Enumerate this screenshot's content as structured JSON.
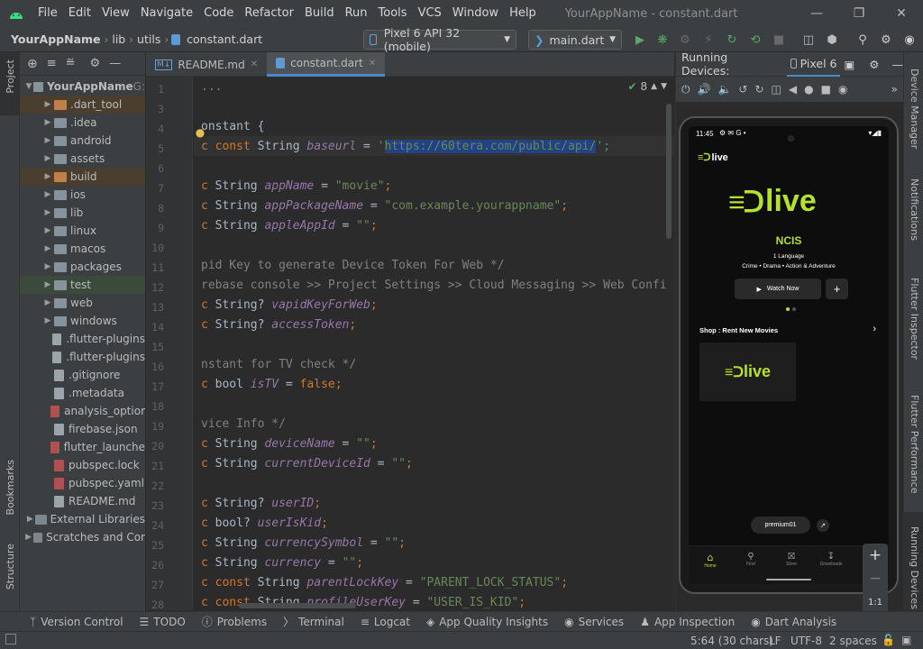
{
  "menu": {
    "items": [
      "File",
      "Edit",
      "View",
      "Navigate",
      "Code",
      "Refactor",
      "Build",
      "Run",
      "Tools",
      "VCS",
      "Window",
      "Help"
    ],
    "window_title": "YourAppName - constant.dart"
  },
  "nav": {
    "crumbs": [
      "YourAppName",
      "lib",
      "utils",
      "constant.dart"
    ],
    "device_combo": "Pixel 6 API 32 (mobile)",
    "run_config": "main.dart"
  },
  "left_stripe": {
    "project": "Project",
    "bookmarks": "Bookmarks",
    "structure": "Structure"
  },
  "right_stripe": {
    "device_manager": "Device Manager",
    "notifications": "Notifications",
    "flutter_inspector": "Flutter Inspector",
    "flutter_performance": "Flutter Performance",
    "running_devices": "Running Devices"
  },
  "project_tree": [
    {
      "label": "YourAppName",
      "suffix": "G:",
      "level": 0,
      "kind": "root",
      "expanded": true
    },
    {
      "label": ".dart_tool",
      "level": 1,
      "kind": "folder-orange",
      "hl": "brown"
    },
    {
      "label": ".idea",
      "level": 1,
      "kind": "folder"
    },
    {
      "label": "android",
      "level": 1,
      "kind": "folder"
    },
    {
      "label": "assets",
      "level": 1,
      "kind": "folder"
    },
    {
      "label": "build",
      "level": 1,
      "kind": "folder-orange",
      "hl": "brown"
    },
    {
      "label": "ios",
      "level": 1,
      "kind": "folder"
    },
    {
      "label": "lib",
      "level": 1,
      "kind": "folder"
    },
    {
      "label": "linux",
      "level": 1,
      "kind": "folder"
    },
    {
      "label": "macos",
      "level": 1,
      "kind": "folder"
    },
    {
      "label": "packages",
      "level": 1,
      "kind": "folder"
    },
    {
      "label": "test",
      "level": 1,
      "kind": "folder",
      "hl": "green"
    },
    {
      "label": "web",
      "level": 1,
      "kind": "folder"
    },
    {
      "label": "windows",
      "level": 1,
      "kind": "folder"
    },
    {
      "label": ".flutter-plugins",
      "level": 1,
      "kind": "file"
    },
    {
      "label": ".flutter-plugins",
      "level": 1,
      "kind": "file"
    },
    {
      "label": ".gitignore",
      "level": 1,
      "kind": "file"
    },
    {
      "label": ".metadata",
      "level": 1,
      "kind": "file"
    },
    {
      "label": "analysis_optior",
      "level": 1,
      "kind": "yml"
    },
    {
      "label": "firebase.json",
      "level": 1,
      "kind": "file"
    },
    {
      "label": "flutter_launche",
      "level": 1,
      "kind": "yml"
    },
    {
      "label": "pubspec.lock",
      "level": 1,
      "kind": "yml"
    },
    {
      "label": "pubspec.yaml",
      "level": 1,
      "kind": "yml"
    },
    {
      "label": "README.md",
      "level": 1,
      "kind": "file"
    },
    {
      "label": "External Libraries",
      "level": 0,
      "kind": "lib"
    },
    {
      "label": "Scratches and Cor",
      "level": 0,
      "kind": "scratch"
    }
  ],
  "tabs": [
    {
      "label": "README.md",
      "active": false
    },
    {
      "label": "constant.dart",
      "active": true
    }
  ],
  "editor": {
    "inspection_count": "8",
    "line_numbers": [
      "1",
      "3",
      "4",
      "5",
      "6",
      "7",
      "8",
      "9",
      "10",
      "11",
      "12",
      "13",
      "14",
      "15",
      "16",
      "17",
      "18",
      "19",
      "20",
      "21",
      "22",
      "23",
      "24",
      "25",
      "26",
      "27",
      "28"
    ],
    "lines": [
      [
        {
          "t": "...",
          "c": "cm"
        }
      ],
      [],
      [
        {
          "t": "onstant {",
          "c": "plain"
        }
      ],
      [
        {
          "t": "c ",
          "c": "kw"
        },
        {
          "t": "const ",
          "c": "kw"
        },
        {
          "t": "String ",
          "c": "plain"
        },
        {
          "t": "baseurl",
          "c": "id"
        },
        {
          "t": " = ",
          "c": "plain"
        },
        {
          "t": "'",
          "c": "str"
        },
        {
          "t": "https://60tera.com/public/api/",
          "c": "str sel"
        },
        {
          "t": "';",
          "c": "str"
        }
      ],
      [],
      [
        {
          "t": "c ",
          "c": "kw"
        },
        {
          "t": "String ",
          "c": "plain"
        },
        {
          "t": "appName",
          "c": "id"
        },
        {
          "t": " = ",
          "c": "plain"
        },
        {
          "t": "\"movie\"",
          "c": "str"
        },
        {
          "t": ";",
          "c": "kw"
        }
      ],
      [
        {
          "t": "c ",
          "c": "kw"
        },
        {
          "t": "String ",
          "c": "plain"
        },
        {
          "t": "appPackageName",
          "c": "id"
        },
        {
          "t": " = ",
          "c": "plain"
        },
        {
          "t": "\"com.example.yourappname\"",
          "c": "str"
        },
        {
          "t": ";",
          "c": "kw"
        }
      ],
      [
        {
          "t": "c ",
          "c": "kw"
        },
        {
          "t": "String ",
          "c": "plain"
        },
        {
          "t": "appleAppId",
          "c": "id"
        },
        {
          "t": " = ",
          "c": "plain"
        },
        {
          "t": "\"\"",
          "c": "str"
        },
        {
          "t": ";",
          "c": "kw"
        }
      ],
      [],
      [
        {
          "t": "pid Key to generate Device Token For Web */",
          "c": "cm"
        }
      ],
      [
        {
          "t": "rebase console >> Project Settings >> Cloud Messaging >> Web Confi",
          "c": "cm"
        }
      ],
      [
        {
          "t": "c ",
          "c": "kw"
        },
        {
          "t": "String? ",
          "c": "plain"
        },
        {
          "t": "vapidKeyForWeb",
          "c": "id"
        },
        {
          "t": ";",
          "c": "kw"
        }
      ],
      [
        {
          "t": "c ",
          "c": "kw"
        },
        {
          "t": "String? ",
          "c": "plain"
        },
        {
          "t": "accessToken",
          "c": "id"
        },
        {
          "t": ";",
          "c": "kw"
        }
      ],
      [],
      [
        {
          "t": "nstant for TV check */",
          "c": "cm"
        }
      ],
      [
        {
          "t": "c ",
          "c": "kw"
        },
        {
          "t": "bool ",
          "c": "plain"
        },
        {
          "t": "isTV",
          "c": "id"
        },
        {
          "t": " = ",
          "c": "plain"
        },
        {
          "t": "false",
          "c": "kw"
        },
        {
          "t": ";",
          "c": "kw"
        }
      ],
      [],
      [
        {
          "t": "vice Info */",
          "c": "cm"
        }
      ],
      [
        {
          "t": "c ",
          "c": "kw"
        },
        {
          "t": "String ",
          "c": "plain"
        },
        {
          "t": "deviceName",
          "c": "id"
        },
        {
          "t": " = ",
          "c": "plain"
        },
        {
          "t": "\"\"",
          "c": "str"
        },
        {
          "t": ";",
          "c": "kw"
        }
      ],
      [
        {
          "t": "c ",
          "c": "kw"
        },
        {
          "t": "String ",
          "c": "plain"
        },
        {
          "t": "currentDeviceId",
          "c": "id"
        },
        {
          "t": " = ",
          "c": "plain"
        },
        {
          "t": "\"\"",
          "c": "str"
        },
        {
          "t": ";",
          "c": "kw"
        }
      ],
      [],
      [
        {
          "t": "c ",
          "c": "kw"
        },
        {
          "t": "String? ",
          "c": "plain"
        },
        {
          "t": "userID",
          "c": "id"
        },
        {
          "t": ";",
          "c": "kw"
        }
      ],
      [
        {
          "t": "c ",
          "c": "kw"
        },
        {
          "t": "bool? ",
          "c": "plain"
        },
        {
          "t": "userIsKid",
          "c": "id"
        },
        {
          "t": ";",
          "c": "kw"
        }
      ],
      [
        {
          "t": "c ",
          "c": "kw"
        },
        {
          "t": "String ",
          "c": "plain"
        },
        {
          "t": "currencySymbol",
          "c": "id"
        },
        {
          "t": " = ",
          "c": "plain"
        },
        {
          "t": "\"\"",
          "c": "str"
        },
        {
          "t": ";",
          "c": "kw"
        }
      ],
      [
        {
          "t": "c ",
          "c": "kw"
        },
        {
          "t": "String ",
          "c": "plain"
        },
        {
          "t": "currency",
          "c": "id"
        },
        {
          "t": " = ",
          "c": "plain"
        },
        {
          "t": "\"\"",
          "c": "str"
        },
        {
          "t": ";",
          "c": "kw"
        }
      ],
      [
        {
          "t": "c ",
          "c": "kw"
        },
        {
          "t": "const ",
          "c": "kw"
        },
        {
          "t": "String ",
          "c": "plain"
        },
        {
          "t": "parentLockKey",
          "c": "id"
        },
        {
          "t": " = ",
          "c": "plain"
        },
        {
          "t": "\"PARENT_LOCK_STATUS\"",
          "c": "str"
        },
        {
          "t": ";",
          "c": "kw"
        }
      ],
      [
        {
          "t": "c ",
          "c": "kw"
        },
        {
          "t": "const ",
          "c": "kw"
        },
        {
          "t": "String ",
          "c": "plain"
        },
        {
          "t": "profileUserKey",
          "c": "id"
        },
        {
          "t": " = ",
          "c": "plain"
        },
        {
          "t": "\"USER_IS_KID\"",
          "c": "str"
        },
        {
          "t": ";",
          "c": "kw"
        }
      ]
    ]
  },
  "running_devices": {
    "title": "Running Devices:",
    "device_tab": "Pixel 6",
    "phone": {
      "status_time": "11:45",
      "logo_text": "live",
      "hero_title": "NCIS",
      "hero_lang": "1 Language",
      "hero_genres": "Crime • Drama • Action & Adventure",
      "watch_now": "Watch Now",
      "section_title": "Shop : Rent New Movies",
      "pill_text": "premium01",
      "nav": [
        "Home",
        "Find",
        "Store",
        "Downloads",
        "More"
      ],
      "zoom_ratio": "1:1"
    }
  },
  "bottom_tools": [
    "Version Control",
    "TODO",
    "Problems",
    "Terminal",
    "Logcat",
    "App Quality Insights",
    "Services",
    "App Inspection",
    "Dart Analysis"
  ],
  "status": {
    "position": "5:64 (30 chars)",
    "line_sep": "LF",
    "encoding": "UTF-8",
    "indent": "2 spaces"
  },
  "colors": {
    "accent": "#4a88c7",
    "lime": "#b6e22a"
  }
}
